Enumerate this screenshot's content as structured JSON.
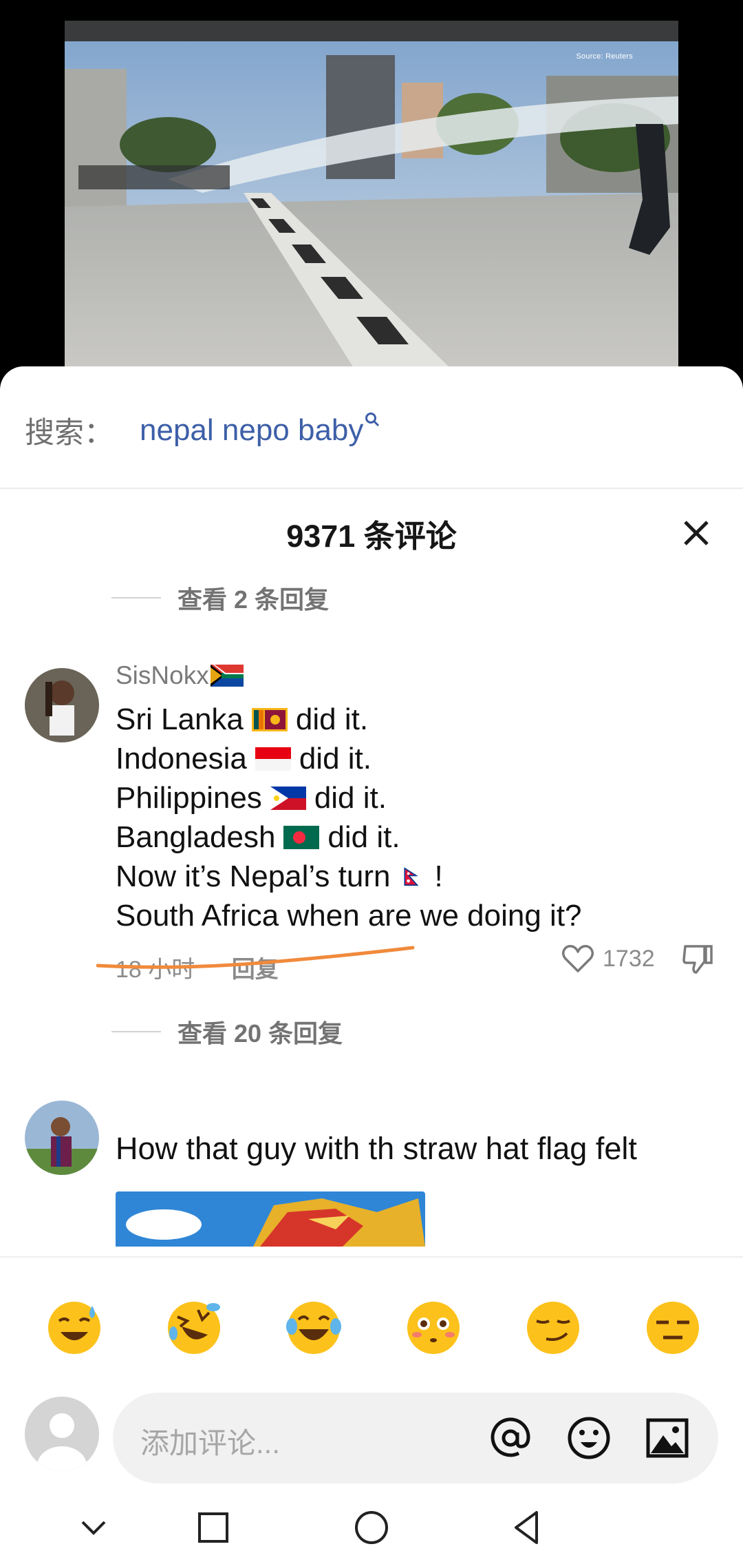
{
  "video": {
    "source_label": "Source: Reuters"
  },
  "search": {
    "label": "搜索：",
    "query": "nepal nepo baby"
  },
  "comments": {
    "header": "9371 条评论",
    "top_replies_label": "查看 2 条回复",
    "items": [
      {
        "username": "SisNokx",
        "username_flag": "south-africa-flag",
        "lines": [
          {
            "before": "Sri Lanka",
            "flag": "sri-lanka-flag",
            "after": "did it."
          },
          {
            "before": "Indonesia",
            "flag": "indonesia-flag",
            "after": "did it."
          },
          {
            "before": "Philippines",
            "flag": "philippines-flag",
            "after": "did it."
          },
          {
            "before": "Bangladesh",
            "flag": "bangladesh-flag",
            "after": "did it."
          },
          {
            "before": "Now it’s Nepal’s turn",
            "flag": "nepal-flag",
            "after": "!"
          },
          {
            "before": "South Africa when are we doing it?",
            "flag": "",
            "after": ""
          }
        ],
        "time": "18 小时",
        "reply": "回复",
        "likes": "1732",
        "replies_label": "查看 20 条回复"
      },
      {
        "text": "How that guy with th straw hat flag felt"
      }
    ]
  },
  "emoji_bar": [
    "sweat-smile-emoji",
    "rofl-emoji",
    "joy-emoji",
    "flushed-emoji",
    "smirk-emoji",
    "expressionless-emoji"
  ],
  "composer": {
    "placeholder": "添加评论...",
    "icons": [
      "at-icon",
      "emoji-icon",
      "image-icon"
    ]
  },
  "nav": [
    "back-chevron-icon",
    "recents-square-icon",
    "home-circle-icon",
    "back-triangle-icon"
  ],
  "colors": {
    "accent_link": "#3d5fa8",
    "annotation_orange": "#f08a3c"
  }
}
